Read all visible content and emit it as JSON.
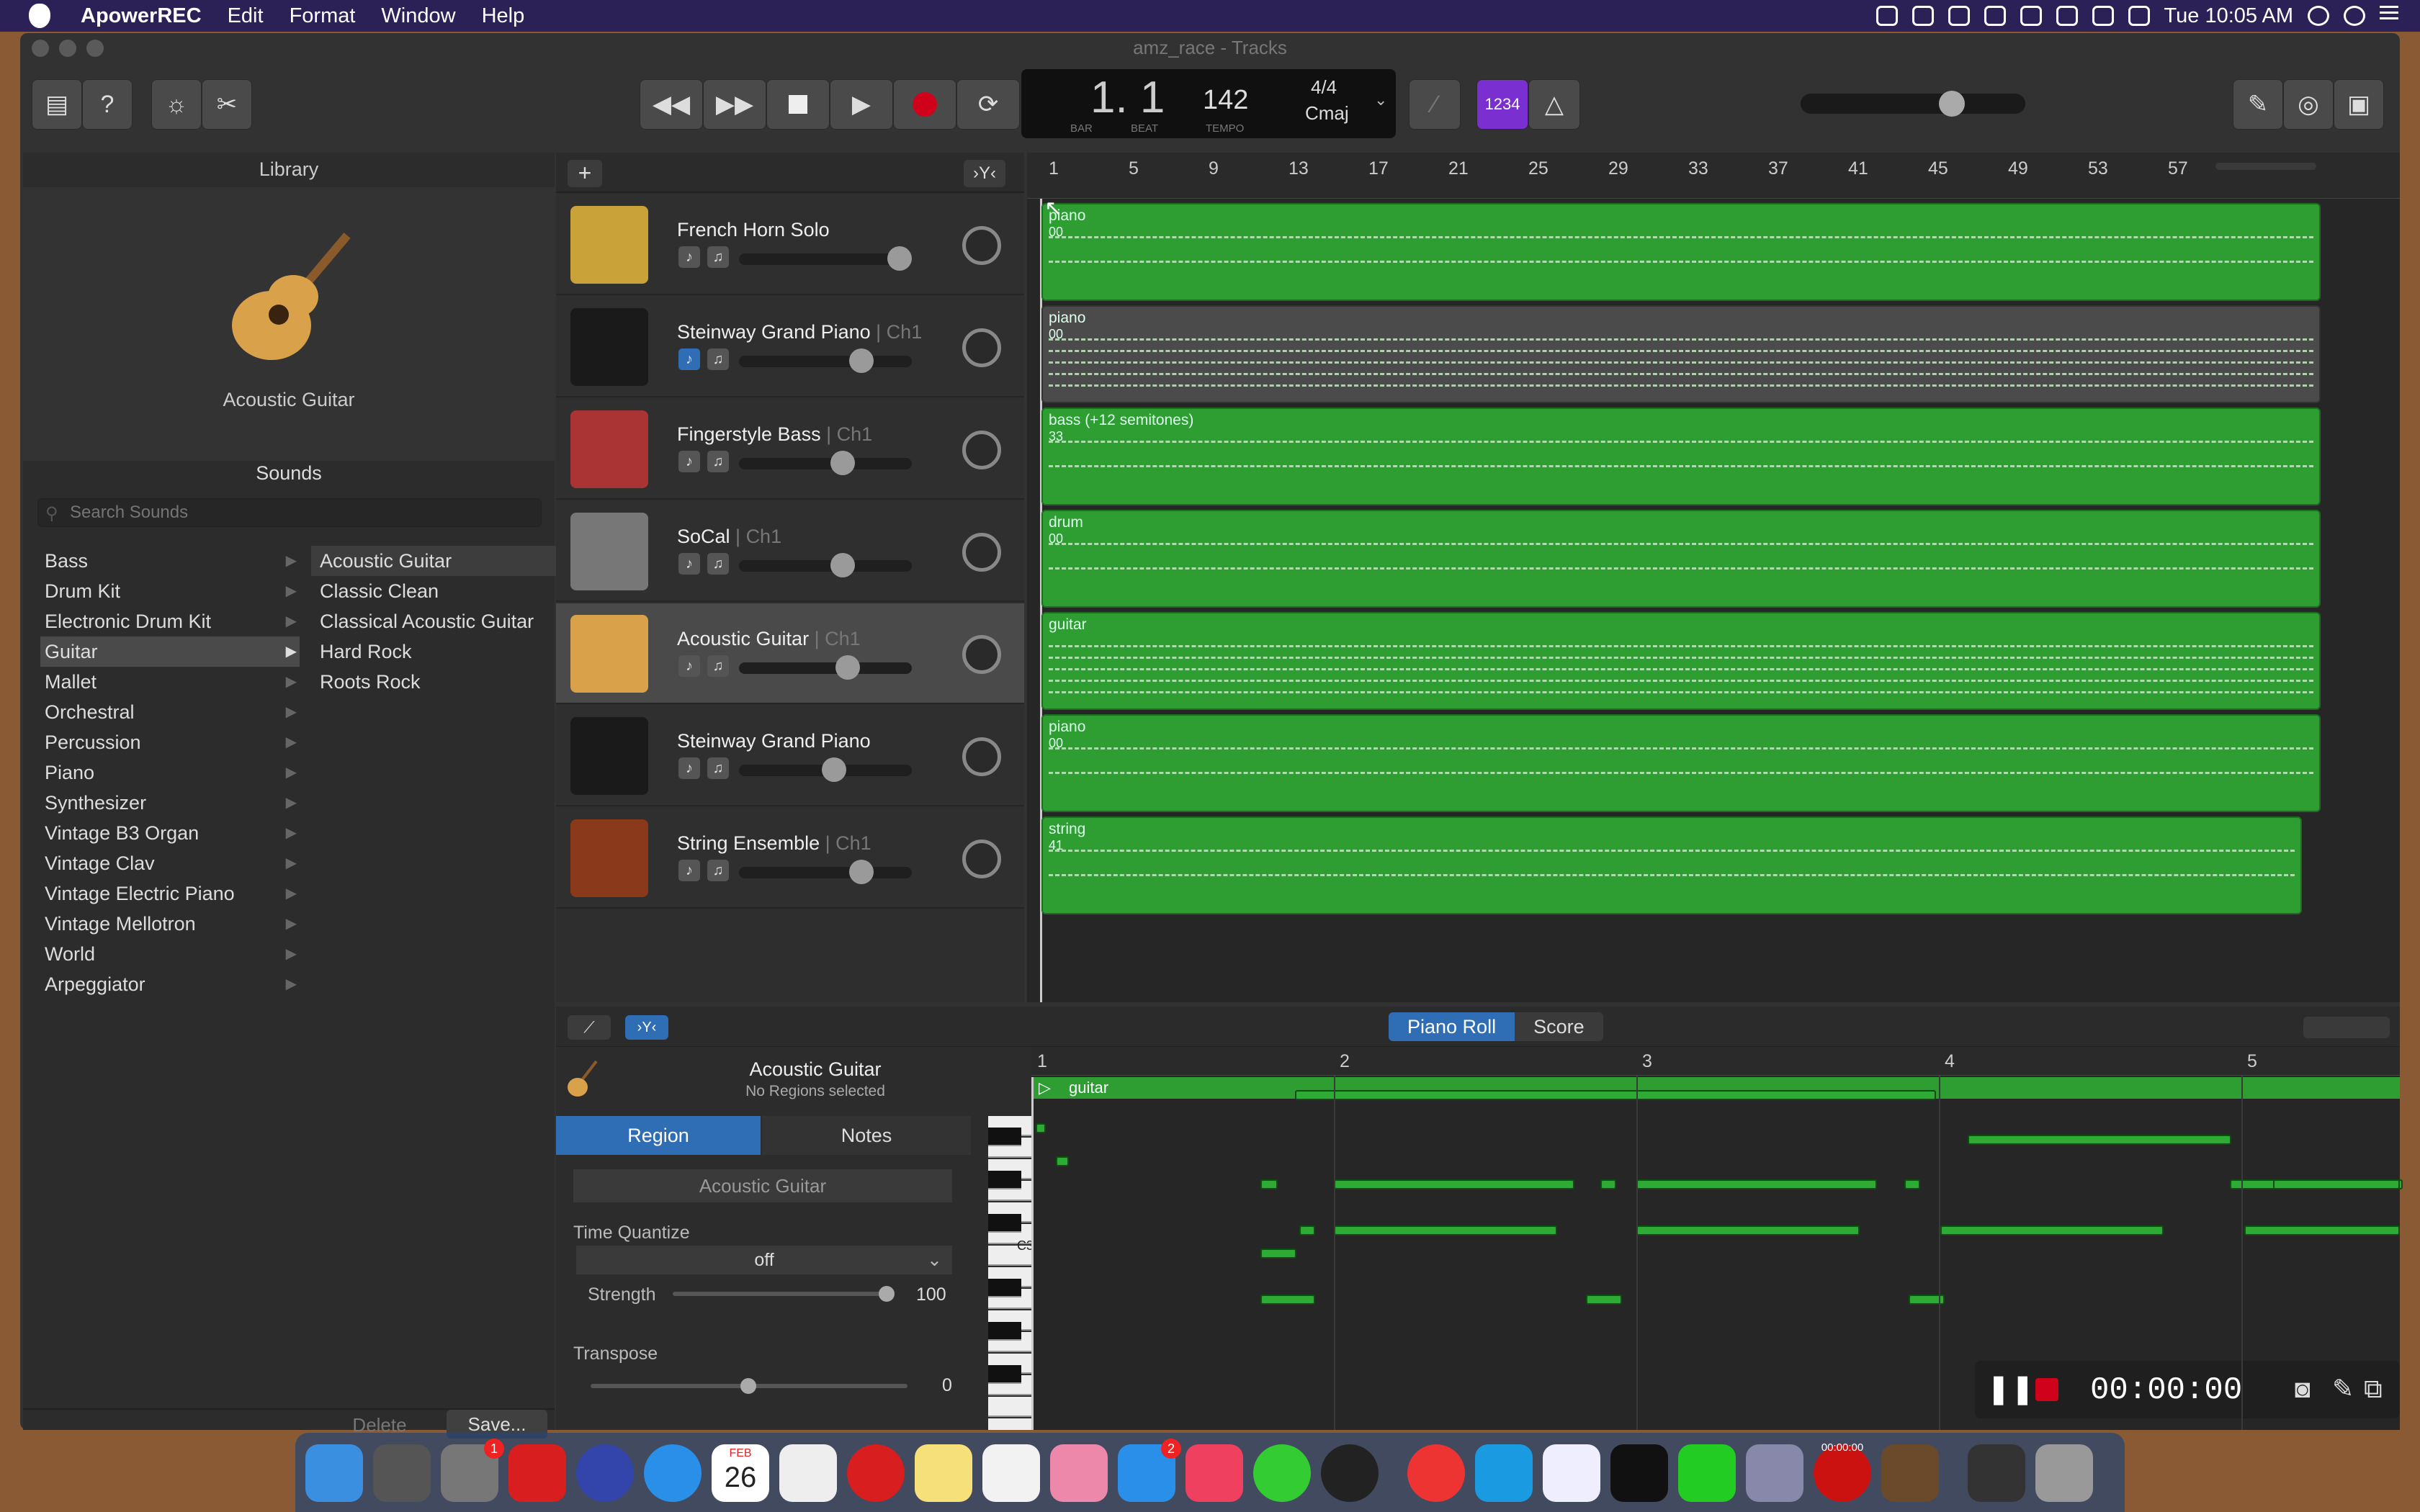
{
  "menubar": {
    "app": "ApowerREC",
    "items": [
      "Edit",
      "Format",
      "Window",
      "Help"
    ],
    "clock": "Tue 10:05 AM"
  },
  "window": {
    "title": "amz_race - Tracks"
  },
  "lcd": {
    "bar_beat": "1. 1",
    "bar_label": "BAR",
    "beat_label": "BEAT",
    "tempo": "142",
    "tempo_label": "TEMPO",
    "time_sig": "4/4",
    "key": "Cmaj"
  },
  "count_in": "1234",
  "library": {
    "title": "Library",
    "instrument_name": "Acoustic Guitar",
    "sounds_title": "Sounds",
    "search_placeholder": "Search Sounds",
    "categories": [
      "Bass",
      "Drum Kit",
      "Electronic Drum Kit",
      "Guitar",
      "Mallet",
      "Orchestral",
      "Percussion",
      "Piano",
      "Synthesizer",
      "Vintage B3 Organ",
      "Vintage Clav",
      "Vintage Electric Piano",
      "Vintage Mellotron",
      "World",
      "Arpeggiator"
    ],
    "selected_category": "Guitar",
    "sounds": [
      "Acoustic Guitar",
      "Classic Clean",
      "Classical Acoustic Guitar",
      "Hard Rock",
      "Roots Rock"
    ],
    "selected_sound": "Acoustic Guitar",
    "delete_label": "Delete",
    "save_label": "Save..."
  },
  "tracks": [
    {
      "name": "French Horn Solo",
      "ch": "",
      "volume": 0.93,
      "icon": "french-horn-icon"
    },
    {
      "name": "Steinway Grand Piano",
      "ch": " | Ch1",
      "volume": 0.71,
      "icon": "grand-piano-icon"
    },
    {
      "name": "Fingerstyle Bass",
      "ch": " | Ch1",
      "volume": 0.6,
      "icon": "bass-guitar-icon"
    },
    {
      "name": "SoCal",
      "ch": " | Ch1",
      "volume": 0.6,
      "icon": "drum-kit-icon"
    },
    {
      "name": "Acoustic Guitar",
      "ch": " | Ch1",
      "volume": 0.63,
      "icon": "acoustic-guitar-icon"
    },
    {
      "name": "Steinway Grand Piano",
      "ch": "",
      "volume": 0.55,
      "icon": "grand-piano-icon"
    },
    {
      "name": "String Ensemble",
      "ch": " | Ch1",
      "volume": 0.71,
      "icon": "cello-icon"
    }
  ],
  "regions": [
    {
      "label": "piano",
      "sub": "00",
      "grey": false
    },
    {
      "label": "piano",
      "sub": "00",
      "grey": true
    },
    {
      "label": "bass (+12 semitones)",
      "sub": "33",
      "grey": false
    },
    {
      "label": "drum",
      "sub": "00",
      "grey": false
    },
    {
      "label": "guitar",
      "sub": "",
      "grey": false
    },
    {
      "label": "piano",
      "sub": "00",
      "grey": false
    },
    {
      "label": "string",
      "sub": "41",
      "grey": false
    }
  ],
  "ruler": [
    "1",
    "5",
    "9",
    "13",
    "17",
    "21",
    "25",
    "29",
    "33",
    "37",
    "41",
    "45",
    "49",
    "53",
    "57"
  ],
  "editor": {
    "tabs": [
      "Piano Roll",
      "Score"
    ],
    "active_tab": "Piano Roll",
    "track_name": "Acoustic Guitar",
    "regions_status": "No Regions selected",
    "inspector_tabs": [
      "Region",
      "Notes"
    ],
    "region_name": "Acoustic Guitar",
    "time_quantize_label": "Time Quantize",
    "time_quantize_value": "off",
    "strength_label": "Strength",
    "strength_value": "100",
    "transpose_label": "Transpose",
    "transpose_value": "0",
    "ruler": [
      "1",
      "2",
      "3",
      "4",
      "5"
    ],
    "region_label": "guitar",
    "key_label": "C3"
  },
  "recorder": {
    "time": "00:00:00"
  },
  "dock": {
    "badge_prefs": "1",
    "badge_appstore": "2",
    "calendar_month": "FEB",
    "calendar_day": "26",
    "rec_time": "00:00:00"
  },
  "colors": {
    "region_green": "#2e9e33",
    "menubar": "#2c2157",
    "record_red": "#d0021b",
    "accent_blue": "#2f6db5",
    "count_in_purple": "#7a2fd0"
  }
}
